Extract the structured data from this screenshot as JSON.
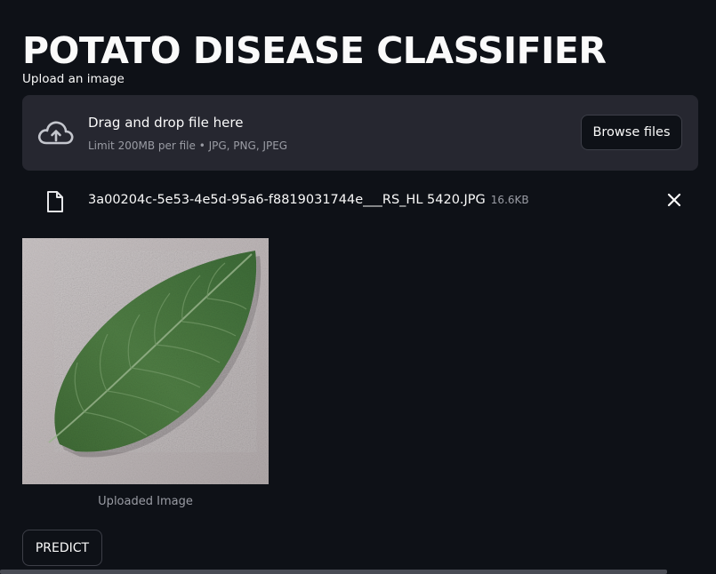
{
  "app": {
    "title": "POTATO DISEASE CLASSIFIER"
  },
  "uploader": {
    "label": "Upload an image",
    "drop_text": "Drag and drop file here",
    "limit_text": "Limit 200MB per file • JPG, PNG, JPEG",
    "browse_label": "Browse files",
    "upload_icon": "cloud-upload-icon"
  },
  "uploaded_file": {
    "name": "3a00204c-5e53-4e5d-95a6-f8819031744e___RS_HL 5420.JPG",
    "size": "16.6KB",
    "file_icon": "file-icon",
    "remove_icon": "close-icon"
  },
  "image": {
    "caption": "Uploaded Image",
    "subject": "potato-leaf"
  },
  "actions": {
    "predict_label": "PREDICT"
  },
  "colors": {
    "background": "#0e1117",
    "panel": "#262730",
    "text": "#fafafa",
    "muted_text": "#9a9ca4",
    "border": "#3d3f48"
  }
}
